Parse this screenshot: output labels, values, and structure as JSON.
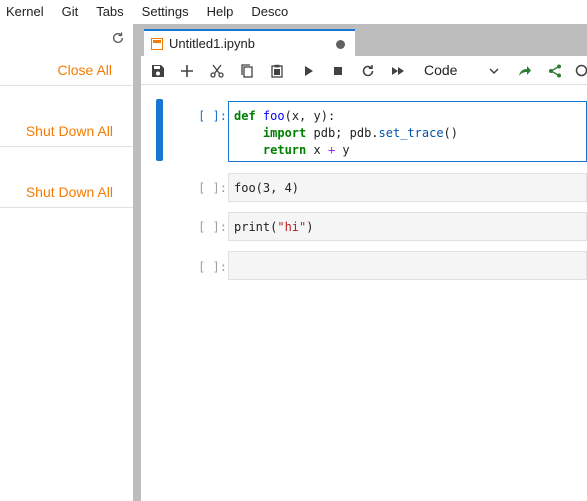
{
  "menubar": {
    "items": [
      "Kernel",
      "Git",
      "Tabs",
      "Settings",
      "Help",
      "Desco"
    ]
  },
  "sidebar": {
    "buttons": [
      "Close All",
      "Shut Down All",
      "Shut Down All"
    ]
  },
  "tab": {
    "title": "Untitled1.ipynb"
  },
  "toolbar": {
    "cell_type": "Code"
  },
  "cells": [
    {
      "prompt": "[ ]:",
      "lines": [
        [
          {
            "t": "def",
            "c": "kw"
          },
          {
            "t": " "
          },
          {
            "t": "foo",
            "c": "fn"
          },
          {
            "t": "(x, y):"
          }
        ],
        [
          {
            "t": "    "
          },
          {
            "t": "import",
            "c": "kw"
          },
          {
            "t": " pdb; pdb."
          },
          {
            "t": "set_trace",
            "c": "at"
          },
          {
            "t": "()"
          }
        ],
        [
          {
            "t": "    "
          },
          {
            "t": "return",
            "c": "kw"
          },
          {
            "t": " x "
          },
          {
            "t": "+",
            "c": "op"
          },
          {
            "t": " y"
          }
        ]
      ]
    },
    {
      "prompt": "[ ]:",
      "lines": [
        [
          {
            "t": "foo(3, 4)"
          }
        ]
      ]
    },
    {
      "prompt": "[ ]:",
      "lines": [
        [
          {
            "t": "print("
          },
          {
            "t": "\"hi\"",
            "c": "str"
          },
          {
            "t": ")"
          }
        ]
      ]
    },
    {
      "prompt": "[ ]:",
      "lines": [
        [
          {
            "t": ""
          }
        ]
      ]
    }
  ],
  "colors": {
    "accent": "#1976d2",
    "sidebar_button": "#f57c00"
  },
  "icons": [
    "refresh-icon",
    "notebook-icon",
    "unsaved-dot-icon",
    "save-icon",
    "add-icon",
    "cut-icon",
    "copy-icon",
    "paste-icon",
    "run-icon",
    "stop-icon",
    "restart-icon",
    "run-all-icon",
    "chevron-down-icon",
    "git-push-icon",
    "share-icon",
    "kernel-status-icon"
  ]
}
